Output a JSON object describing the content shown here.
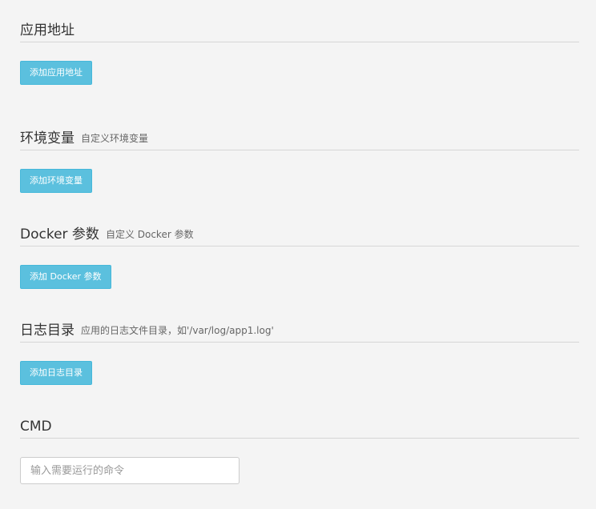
{
  "sections": {
    "app_address": {
      "title": "应用地址",
      "subtitle": "",
      "button_label": "添加应用地址"
    },
    "env_vars": {
      "title": "环境变量",
      "subtitle": "自定义环境变量",
      "button_label": "添加环境变量"
    },
    "docker_params": {
      "title": "Docker 参数",
      "subtitle": "自定义 Docker 参数",
      "button_label": "添加 Docker 参数"
    },
    "log_dirs": {
      "title": "日志目录",
      "subtitle": "应用的日志文件目录，如'/var/log/app1.log'",
      "button_label": "添加日志目录"
    },
    "cmd": {
      "title": "CMD",
      "placeholder": "输入需要运行的命令",
      "value": ""
    }
  }
}
